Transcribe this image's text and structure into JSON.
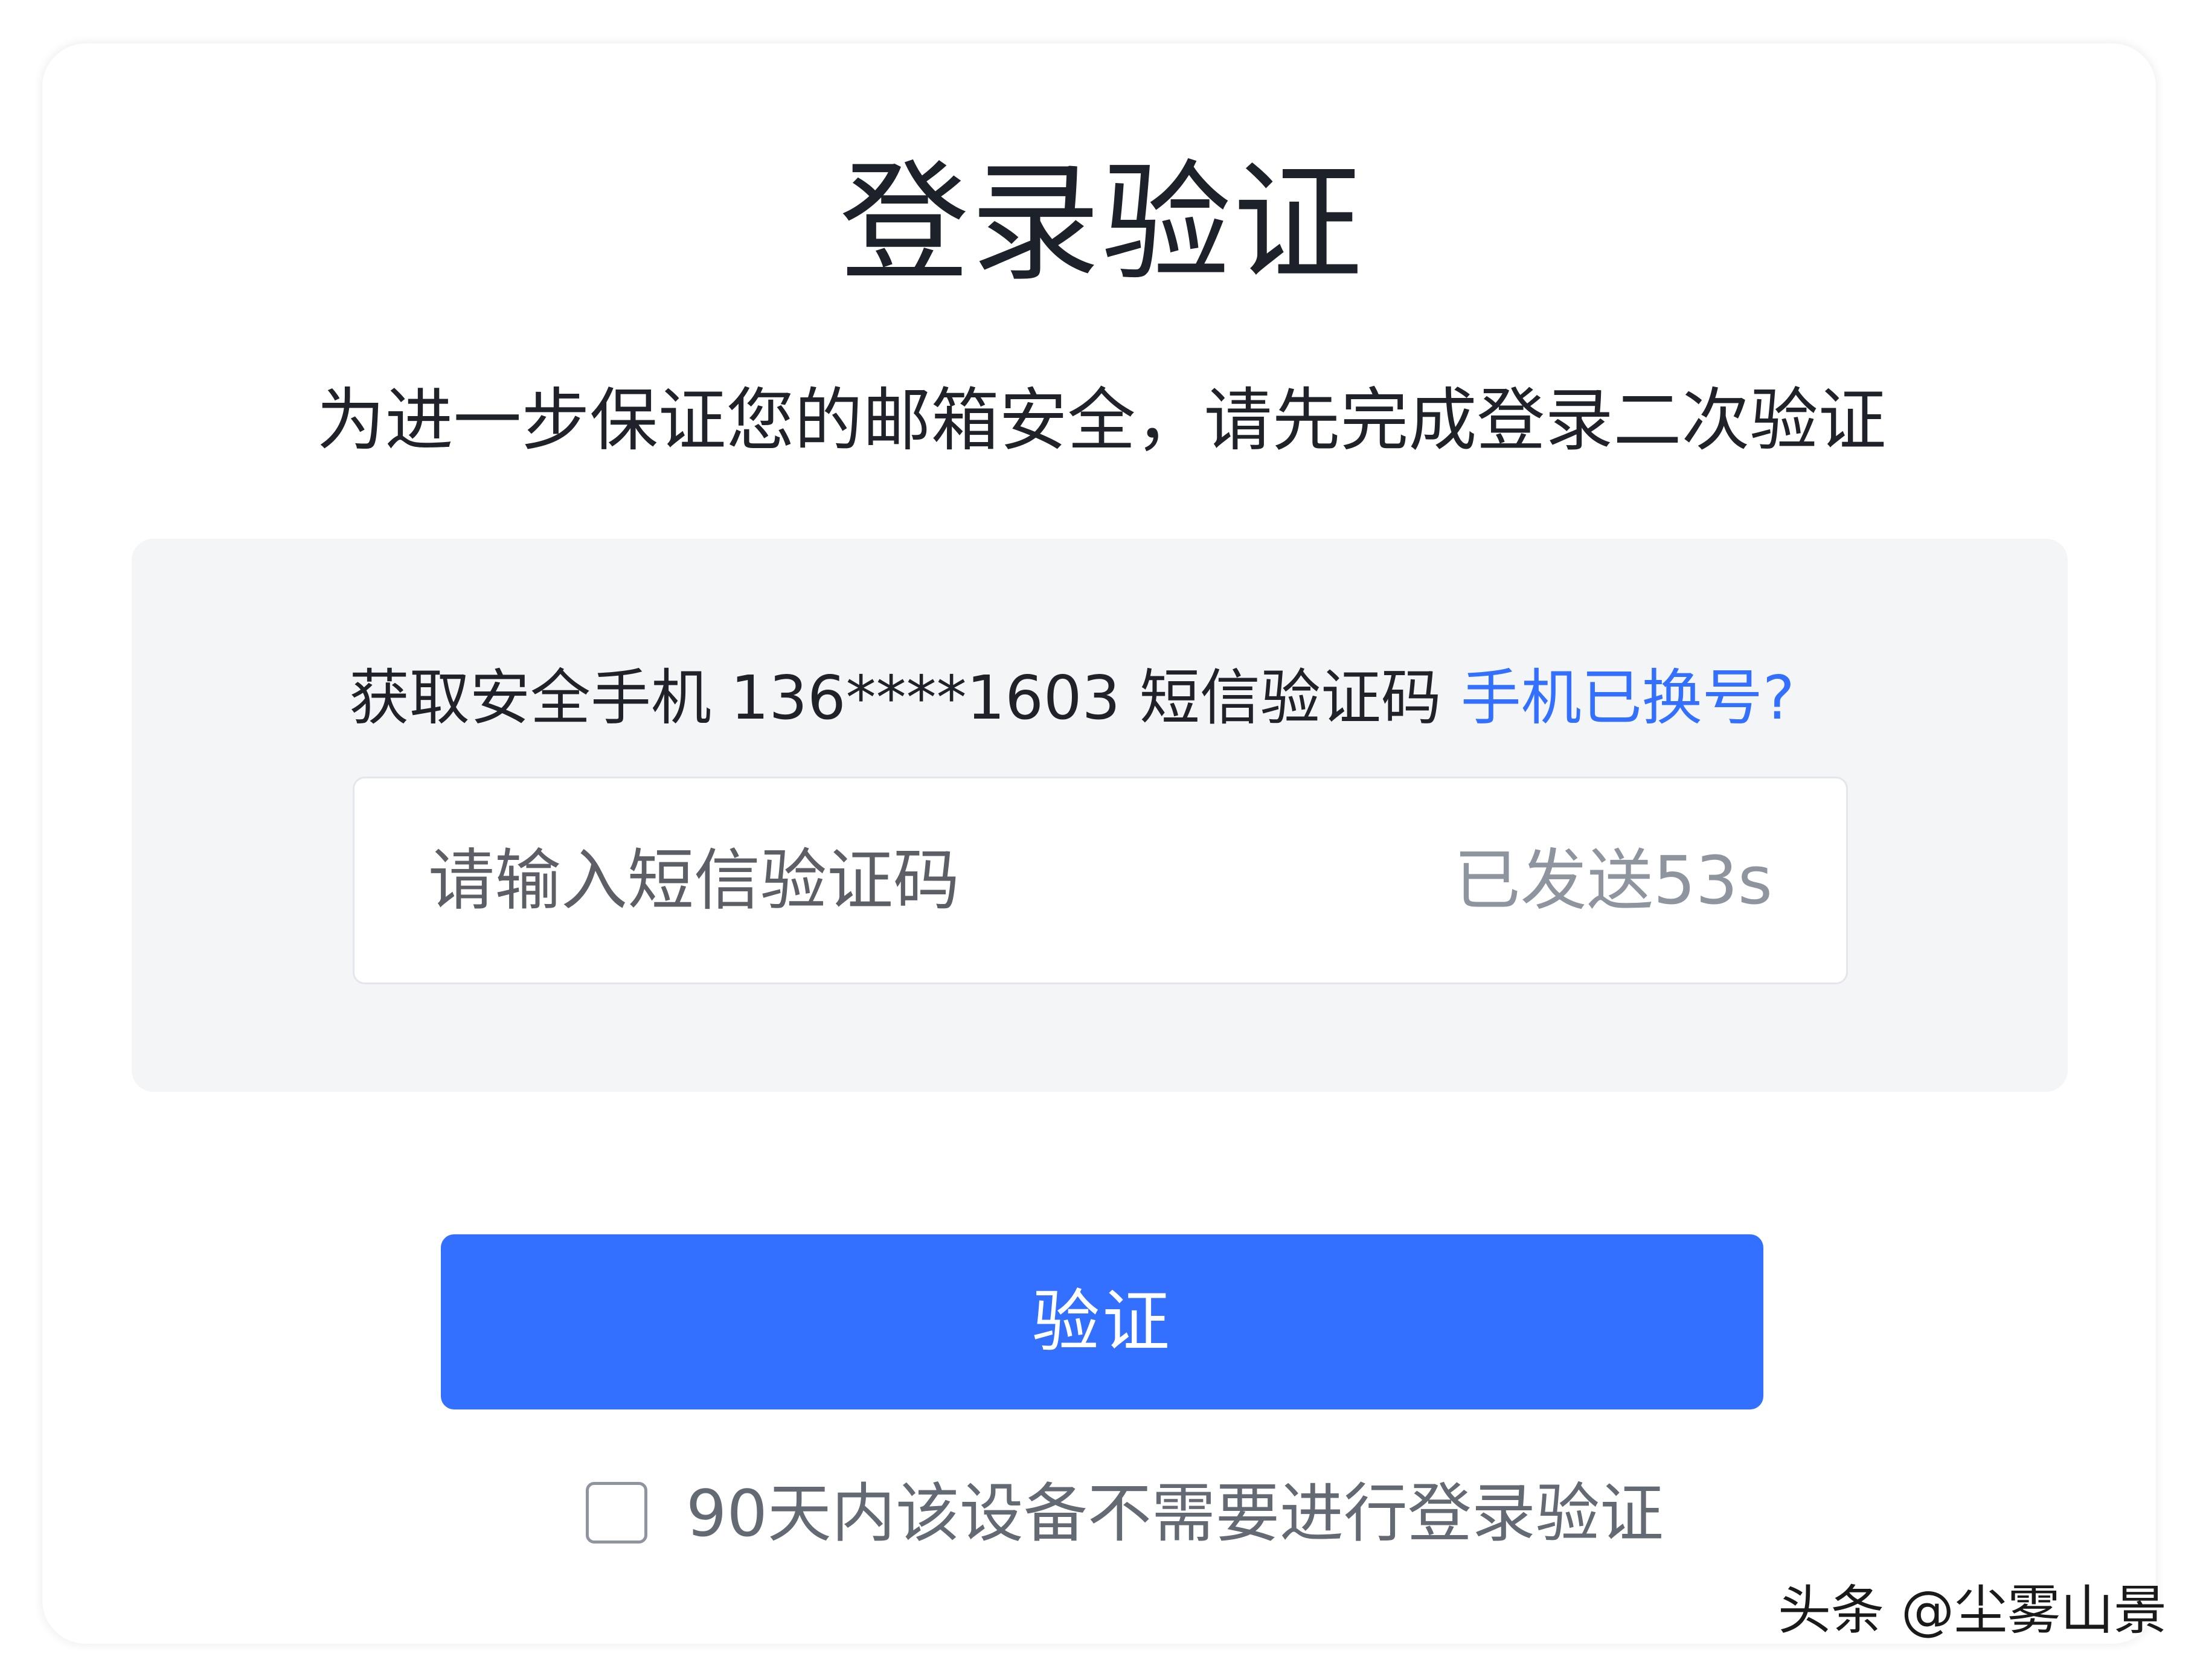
{
  "header": {
    "title": "登录验证",
    "subtitle": "为进一步保证您的邮箱安全，请先完成登录二次验证"
  },
  "verification": {
    "hint_prefix": "获取安全手机 136****1603 短信验证码 ",
    "change_phone_link": "手机已换号?",
    "code_input": {
      "value": "",
      "placeholder": "请输入短信验证码"
    },
    "countdown": "已发送53s"
  },
  "actions": {
    "verify_label": "验证",
    "remember_device_label": "90天内该设备不需要进行登录验证",
    "remember_device_checked": false
  },
  "watermark": {
    "text": "头条 @尘雾山景"
  },
  "colors": {
    "accent": "#3370ff",
    "panel_bg": "#f4f5f7",
    "text_primary": "#1f2329",
    "text_muted": "#8f959e"
  }
}
